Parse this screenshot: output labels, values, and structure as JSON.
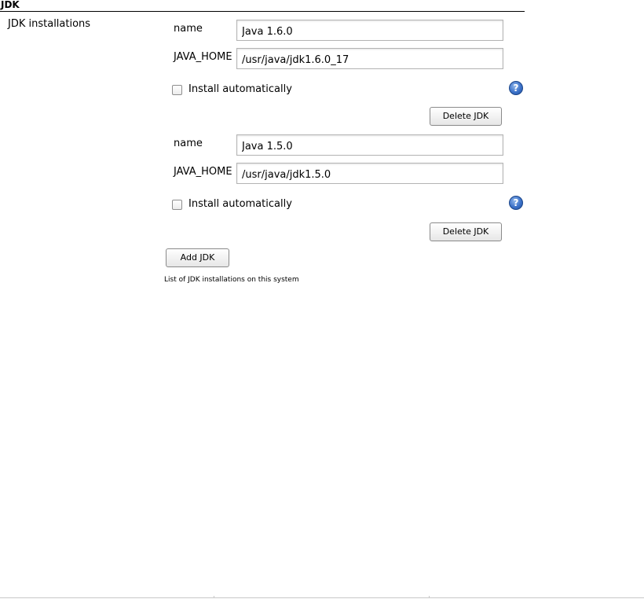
{
  "section": {
    "title": "JDK",
    "label": "JDK installations"
  },
  "jdks": [
    {
      "name_label": "name",
      "name_value": "Java 1.6.0",
      "home_label": "JAVA_HOME",
      "home_value": "/usr/java/jdk1.6.0_17",
      "install_label": "Install automatically",
      "install_checked": false,
      "help_glyph": "?",
      "delete_label": "Delete JDK"
    },
    {
      "name_label": "name",
      "name_value": "Java 1.5.0",
      "home_label": "JAVA_HOME",
      "home_value": "/usr/java/jdk1.5.0",
      "install_label": "Install automatically",
      "install_checked": false,
      "help_glyph": "?",
      "delete_label": "Delete JDK"
    }
  ],
  "add_label": "Add JDK",
  "description": "List of JDK installations on this system",
  "icons": {
    "help": "help-icon",
    "checkbox": "checkbox"
  },
  "colors": {
    "help_blue": "#3c72c9",
    "input_border": "#b4b4b4"
  }
}
